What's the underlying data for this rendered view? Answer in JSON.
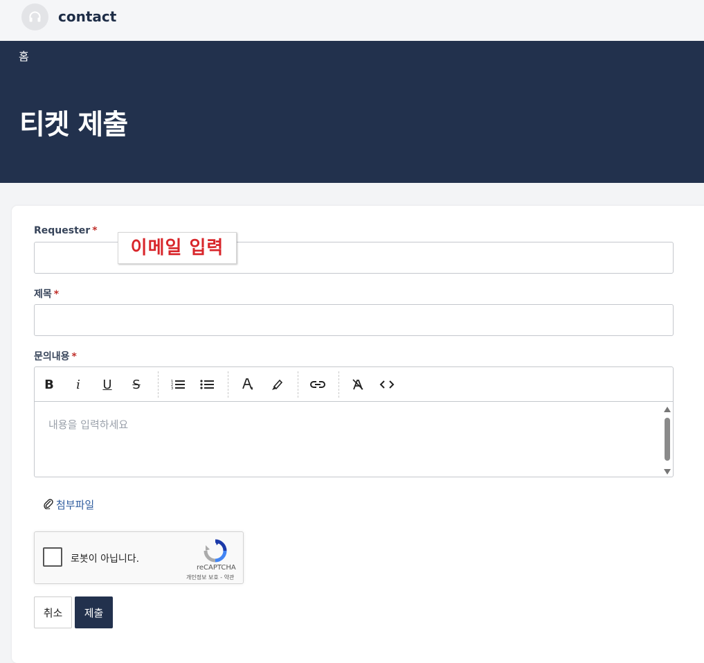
{
  "header": {
    "brand": "contact",
    "logo_icon": "headset-icon"
  },
  "hero": {
    "breadcrumb": "홈",
    "title": "티켓 제출",
    "background": "#22314d"
  },
  "form": {
    "requester": {
      "label": "Requester",
      "required_mark": "*",
      "value": ""
    },
    "tooltip": "이메일 입력",
    "subject": {
      "label": "제목",
      "required_mark": "*",
      "value": ""
    },
    "content": {
      "label": "문의내용",
      "required_mark": "*",
      "placeholder": "내용을 입력하세요",
      "toolbar": [
        "bold-icon",
        "italic-icon",
        "underline-icon",
        "strikethrough-icon",
        "ordered-list-icon",
        "bullet-list-icon",
        "text-color-icon",
        "highlight-icon",
        "link-icon",
        "clear-format-icon",
        "code-icon"
      ]
    },
    "attachment": "첨부파일",
    "recaptcha": {
      "label": "로봇이 아닙니다.",
      "brand": "reCAPTCHA",
      "links": "개인정보 보호 - 약관"
    },
    "buttons": {
      "cancel": "취소",
      "submit": "제출"
    }
  }
}
